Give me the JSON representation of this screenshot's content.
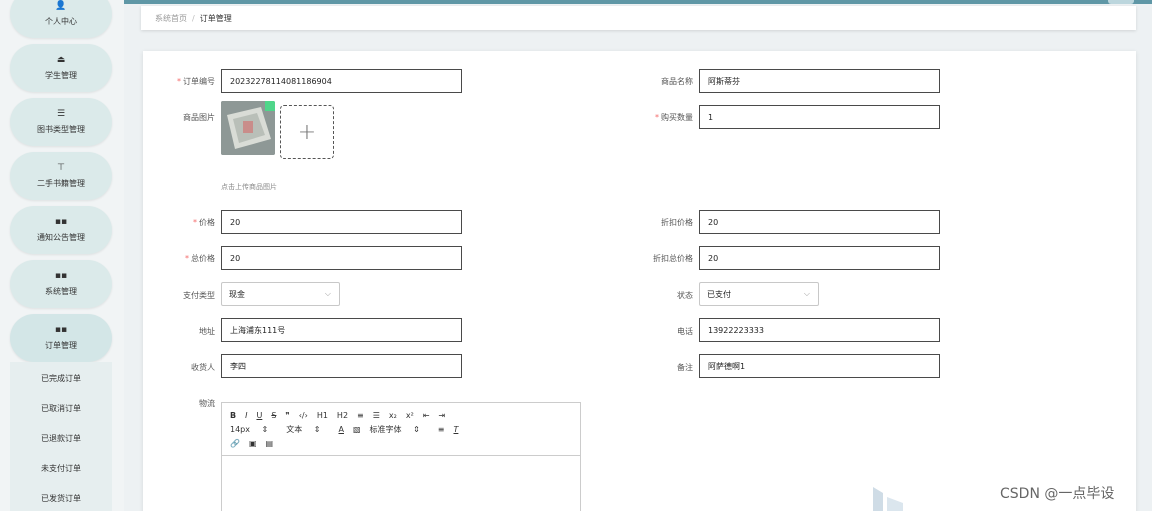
{
  "sidebar": {
    "items": [
      {
        "label": "个人中心",
        "icon": "user-icon",
        "glyph": "👤"
      },
      {
        "label": "学生管理",
        "icon": "briefcase-icon",
        "glyph": "⏏"
      },
      {
        "label": "图书类型管理",
        "icon": "list-icon",
        "glyph": "☰"
      },
      {
        "label": "二手书籍管理",
        "icon": "pin-icon",
        "glyph": "⊤"
      },
      {
        "label": "通知公告管理",
        "icon": "grid-icon",
        "glyph": "▪▪"
      },
      {
        "label": "系统管理",
        "icon": "grid-icon",
        "glyph": "▪▪"
      },
      {
        "label": "订单管理",
        "icon": "grid-icon",
        "glyph": "▪▪"
      }
    ],
    "sub_items": [
      "已完成订单",
      "已取消订单",
      "已退款订单",
      "未支付订单",
      "已发货订单"
    ]
  },
  "breadcrumb": {
    "home": "系统首页",
    "separator": "/",
    "current": "订单管理"
  },
  "form": {
    "order_no": {
      "label": "订单编号",
      "value": "20232278114081186904"
    },
    "product_name": {
      "label": "商品名称",
      "value": "阿斯蒂芬"
    },
    "product_image": {
      "label": "商品图片",
      "hint": "点击上传商品图片"
    },
    "quantity": {
      "label": "购买数量",
      "value": "1"
    },
    "price": {
      "label": "价格",
      "value": "20"
    },
    "discount_price": {
      "label": "折扣价格",
      "value": "20"
    },
    "total_price": {
      "label": "总价格",
      "value": "20"
    },
    "discount_total": {
      "label": "折扣总价格",
      "value": "20"
    },
    "pay_type": {
      "label": "支付类型",
      "value": "现金"
    },
    "status": {
      "label": "状态",
      "value": "已支付"
    },
    "address": {
      "label": "地址",
      "value": "上海浦东111号"
    },
    "phone": {
      "label": "电话",
      "value": "13922223333"
    },
    "receiver": {
      "label": "收货人",
      "value": "李四"
    },
    "remark": {
      "label": "备注",
      "value": "阿萨德啊1"
    },
    "logistics": {
      "label": "物流"
    }
  },
  "editor_toolbar": {
    "row1": [
      "B",
      "I",
      "U",
      "S",
      "❞",
      "‹/›",
      "H1",
      "H2",
      "≡",
      "☰",
      "x₂",
      "x²",
      "⇤",
      "⇥"
    ],
    "size": "14px",
    "text_type": "文本",
    "font": "标准字体"
  },
  "watermark": "CSDN @一点毕设",
  "colors": {
    "accent": "#5f97a6",
    "required": "#f56c6c",
    "sidebar_button": "#dbeaea"
  }
}
